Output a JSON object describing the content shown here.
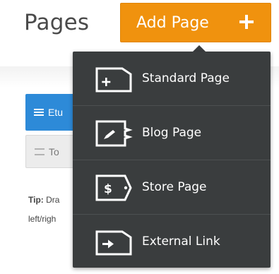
{
  "header": {
    "title": "Pages",
    "add_button_label": "Add Page"
  },
  "colors": {
    "accent": "#f0920e",
    "menu_bg": "#3a3d3e",
    "blue_item": "#2d8ad8"
  },
  "background": {
    "items": [
      {
        "label": "Etu",
        "style": "selected"
      },
      {
        "label": "To",
        "style": "normal"
      }
    ],
    "tip_label": "Tip:",
    "tip_text_line1": "Dra",
    "tip_text_line2": "left/righ"
  },
  "dropdown": {
    "items": [
      {
        "label": "Standard Page",
        "icon": "plus-page-icon"
      },
      {
        "label": "Blog Page",
        "icon": "pencil-page-icon"
      },
      {
        "label": "Store Page",
        "icon": "dollar-page-icon"
      },
      {
        "label": "External Link",
        "icon": "arrow-page-icon"
      }
    ]
  }
}
